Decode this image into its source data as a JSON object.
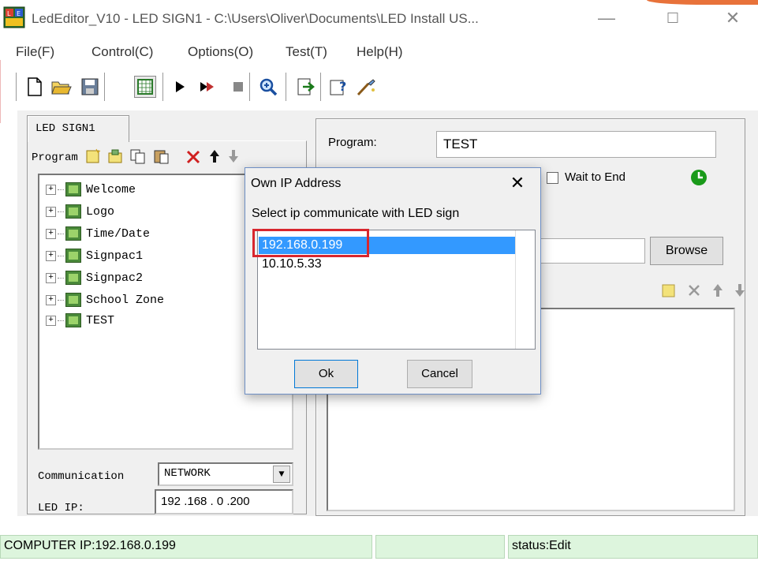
{
  "window": {
    "title": "LedEditor_V10 - LED SIGN1 - C:\\Users\\Oliver\\Documents\\LED Install US...",
    "minimize_glyph": "—",
    "maximize_glyph": "☐",
    "close_glyph": "✕",
    "accent_color": "#e8723a"
  },
  "menu": {
    "items": [
      {
        "label": "File(F)"
      },
      {
        "label": "Control(C)"
      },
      {
        "label": "Options(O)"
      },
      {
        "label": "Test(T)"
      },
      {
        "label": "Help(H)"
      }
    ]
  },
  "toolbar": {
    "icons": [
      "new-file-icon",
      "open-folder-icon",
      "save-icon",
      "grid-icon",
      "play-icon",
      "step-icon",
      "stop-icon",
      "zoom-icon",
      "export-icon",
      "help-icon",
      "wand-icon"
    ]
  },
  "left_panel": {
    "tab_label": "LED SIGN1",
    "program_label": "Program",
    "programs": [
      "Welcome",
      "Logo",
      "Time/Date",
      "Signpac1",
      "Signpac2",
      "School Zone",
      "TEST"
    ],
    "communication_label": "Communication",
    "communication_value": "NETWORK",
    "led_ip_label": "LED IP:",
    "led_ip_value": "192 .168 . 0  .200"
  },
  "right_panel": {
    "program_label": "Program:",
    "program_value": "TEST",
    "wait_to_end_label": "Wait to End",
    "wait_to_end_checked": false,
    "browse_label": "Browse"
  },
  "status_bar": {
    "computer_ip": "COMPUTER IP:192.168.0.199",
    "middle": "",
    "status": "status:Edit",
    "color": "#ddf5dd"
  },
  "dialog": {
    "title": "Own IP Address",
    "close_glyph": "✕",
    "prompt": "Select ip communicate with LED sign",
    "options": [
      "192.168.0.199",
      "10.10.5.33"
    ],
    "selected_index": 0,
    "ok_label": "Ok",
    "cancel_label": "Cancel",
    "highlight_color": "#d8262e",
    "selection_color": "#3399ff"
  }
}
